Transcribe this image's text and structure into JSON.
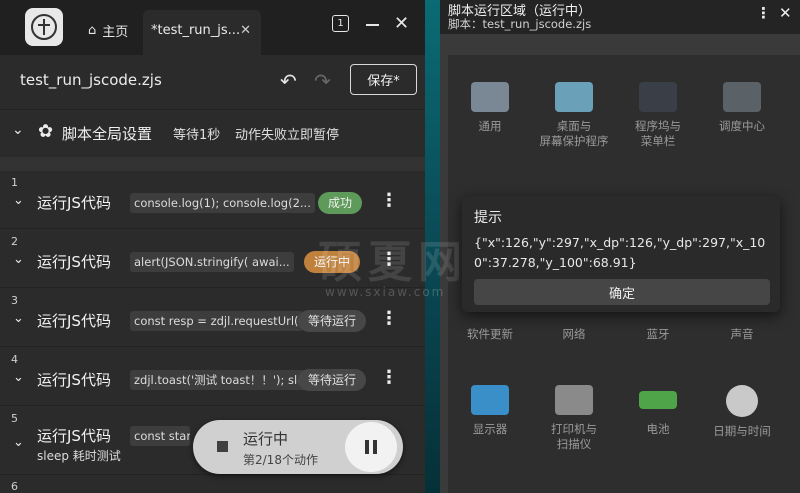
{
  "left": {
    "home_tab": "主页",
    "active_tab": "*test_run_js...",
    "tab_count_badge": "1",
    "file_name": "test_run_jscode.zjs",
    "save_label": "保存*",
    "global": {
      "title": "脚本全局设置",
      "wait": "等待1秒",
      "on_fail": "动作失败立即暂停"
    },
    "actions": [
      {
        "num": "1",
        "title": "运行JS代码",
        "code": "console.log(1); console.log(2...",
        "status": "成功"
      },
      {
        "num": "2",
        "title": "运行JS代码",
        "code": "alert(JSON.stringify( awai...",
        "status": "运行中"
      },
      {
        "num": "3",
        "title": "运行JS代码",
        "code": "const resp = zdjl.requestUrl(",
        "status": "等待运行"
      },
      {
        "num": "4",
        "title": "运行JS代码",
        "code": "zdjl.toast('测试 toast！！'); sle",
        "status": "等待运行"
      },
      {
        "num": "5",
        "title": "运行JS代码",
        "code": "const start",
        "sub": "sleep 耗时测试"
      },
      {
        "num": "6"
      }
    ],
    "runner": {
      "title": "运行中",
      "progress": "第2/18个动作"
    }
  },
  "right": {
    "title": "脚本运行区域（运行中）",
    "script_label": "脚本：test_run_jscode.zjs",
    "prefs": [
      {
        "label": "通用",
        "color": "#7a8794"
      },
      {
        "label": "桌面与\n屏幕保护程序",
        "color": "#6aa0b8"
      },
      {
        "label": "程序坞与\n菜单栏",
        "color": "#3a3f47"
      },
      {
        "label": "调度中心",
        "color": "#5a6167"
      },
      {
        "label": "软件更新",
        "color": "#6d7378"
      },
      {
        "label": "网络",
        "color": "#4a7fb0"
      },
      {
        "label": "蓝牙",
        "color": "#3f74c7"
      },
      {
        "label": "声音",
        "color": "#707070"
      },
      {
        "label": "显示器",
        "color": "#3b8fc9"
      },
      {
        "label": "打印机与\n扫描仪",
        "color": "#8a8a8a"
      },
      {
        "label": "电池",
        "color": "#4fa44a"
      },
      {
        "label": "日期与时间",
        "color": "#c9c9c9"
      }
    ],
    "dialog": {
      "title": "提示",
      "message": "{\"x\":126,\"y\":297,\"x_dp\":126,\"y_dp\":297,\"x_100\":37.278,\"y_100\":68.91}",
      "ok_label": "确定"
    }
  },
  "watermark": {
    "text": "硕夏网",
    "url": "www.sxiaw.com"
  }
}
